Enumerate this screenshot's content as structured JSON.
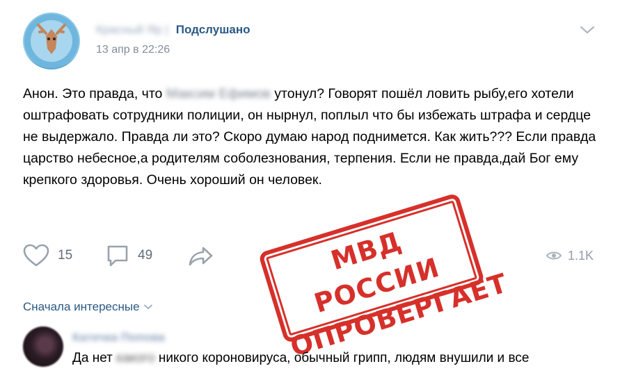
{
  "post": {
    "author_blurred": "Красный Яр",
    "separator": "|",
    "group": "Подслушано",
    "date": "13 апр в 22:26",
    "text_before": "Анон. Это правда, что ",
    "text_blurred": "Максим Ефимов",
    "text_after": " утонул? Говорят пошёл ловить рыбу,его хотели оштрафовать сотрудники полиции, он нырнул, поплыл что бы избежать штрафа и сердце не выдержало. Правда ли это? Скоро думаю народ поднимется. Как жить??? Если правда царство небесное,а родителям соболезнования, терпения. Если не правда,дай Бог ему крепкого здоровья. Очень хороший он человек."
  },
  "actions": {
    "likes": "15",
    "comments": "49",
    "views": "1.1K"
  },
  "stamp": {
    "line1": "МВД РОССИИ",
    "line2": "ОПРОВЕРГАЕТ"
  },
  "comments_section": {
    "sort_label": "Сначала интересные"
  },
  "comment": {
    "author_blurred": "Катечка Попова",
    "text_before": "Да нет ",
    "text_blurred": "какого",
    "text_after": " никого короновируса, обычный грипп, людям внушили и все"
  },
  "colors": {
    "link": "#2a5885",
    "muted": "#818c99",
    "stamp": "#d6302a",
    "icon": "#99a2ad"
  }
}
